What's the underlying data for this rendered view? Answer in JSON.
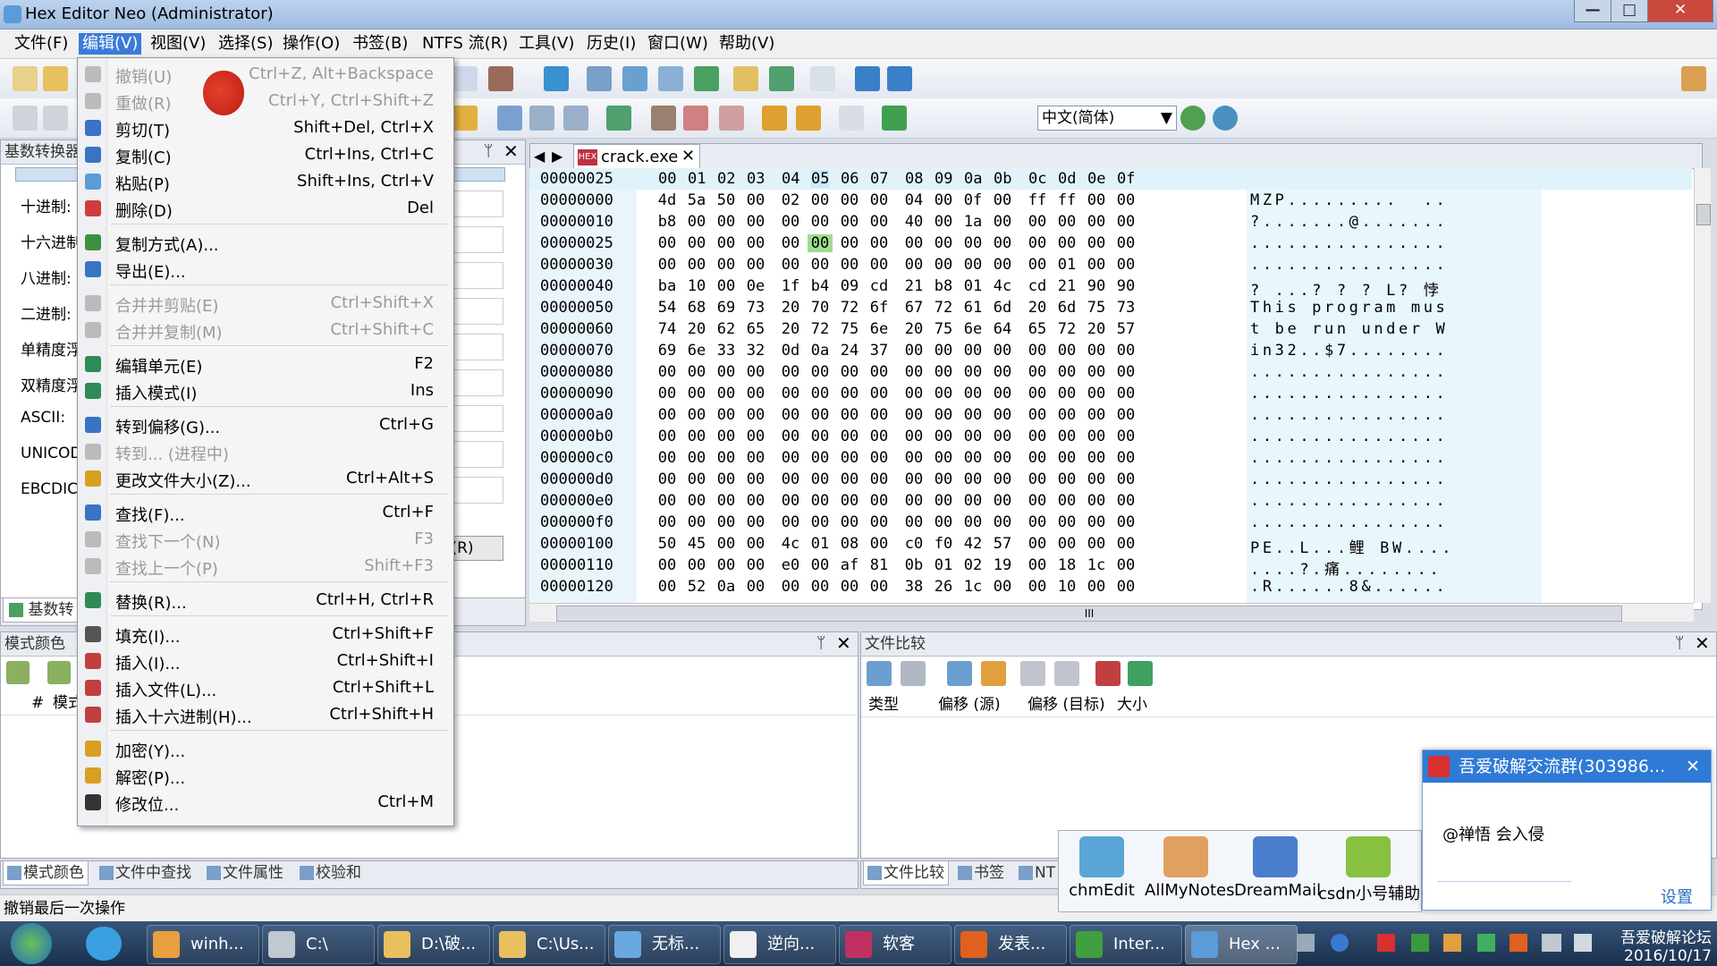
{
  "window": {
    "title": "Hex Editor Neo (Administrator)",
    "min": "—",
    "max": "□",
    "close": "✕"
  },
  "menubar": [
    {
      "label": "文件(F)"
    },
    {
      "label": "编辑(V)"
    },
    {
      "label": "视图(V)"
    },
    {
      "label": "选择(S)"
    },
    {
      "label": "操作(O)"
    },
    {
      "label": "书签(B)"
    },
    {
      "label": "NTFS 流(R)"
    },
    {
      "label": "工具(V)"
    },
    {
      "label": "历史(I)"
    },
    {
      "label": "窗口(W)"
    },
    {
      "label": "帮助(V)"
    }
  ],
  "language_select": {
    "value": "中文(简体)"
  },
  "edit_menu": [
    {
      "label": "撤销(U)",
      "shortcut": "Ctrl+Z, Alt+Backspace",
      "disabled": true,
      "icon": "undo-icon",
      "color": "#bbbbbb"
    },
    {
      "label": "重做(R)",
      "shortcut": "Ctrl+Y, Ctrl+Shift+Z",
      "disabled": true,
      "icon": "redo-icon",
      "color": "#bbbbbb"
    },
    {
      "label": "剪切(T)",
      "shortcut": "Shift+Del, Ctrl+X",
      "disabled": false,
      "icon": "cut-icon",
      "color": "#3a73c4"
    },
    {
      "label": "复制(C)",
      "shortcut": "Ctrl+Ins, Ctrl+C",
      "disabled": false,
      "icon": "copy-icon",
      "color": "#3a73c4"
    },
    {
      "label": "粘贴(P)",
      "shortcut": "Shift+Ins, Ctrl+V",
      "disabled": false,
      "icon": "paste-icon",
      "color": "#5a9bd8"
    },
    {
      "label": "删除(D)",
      "shortcut": "Del",
      "disabled": false,
      "icon": "delete-icon",
      "color": "#d23b3b"
    },
    {
      "label": "复制方式(A)...",
      "shortcut": "",
      "disabled": false,
      "icon": "copy-as-icon",
      "color": "#3f8f3f"
    },
    {
      "label": "导出(E)...",
      "shortcut": "",
      "disabled": false,
      "icon": "export-icon",
      "color": "#3a73c4"
    },
    {
      "label": "合并并剪贴(E)",
      "shortcut": "Ctrl+Shift+X",
      "disabled": true,
      "icon": "merge-cut-icon",
      "color": "#bbbbbb"
    },
    {
      "label": "合并并复制(M)",
      "shortcut": "Ctrl+Shift+C",
      "disabled": true,
      "icon": "merge-copy-icon",
      "color": "#bbbbbb"
    },
    {
      "label": "编辑单元(E)",
      "shortcut": "F2",
      "disabled": false,
      "icon": "edit-cell-icon",
      "color": "#2e8b57"
    },
    {
      "label": "插入模式(I)",
      "shortcut": "Ins",
      "disabled": false,
      "icon": "insert-mode-icon",
      "color": "#2e8b57"
    },
    {
      "label": "转到偏移(G)...",
      "shortcut": "Ctrl+G",
      "disabled": false,
      "icon": "goto-icon",
      "color": "#3a73c4"
    },
    {
      "label": "转到... (进程中)",
      "shortcut": "",
      "disabled": true,
      "icon": "goto-process-icon",
      "color": "#bbbbbb"
    },
    {
      "label": "更改文件大小(Z)...",
      "shortcut": "Ctrl+Alt+S",
      "disabled": false,
      "icon": "resize-icon",
      "color": "#d8a020"
    },
    {
      "label": "查找(F)...",
      "shortcut": "Ctrl+F",
      "disabled": false,
      "icon": "find-icon",
      "color": "#3a73c4"
    },
    {
      "label": "查找下一个(N)",
      "shortcut": "F3",
      "disabled": true,
      "icon": "find-next-icon",
      "color": "#bbbbbb"
    },
    {
      "label": "查找上一个(P)",
      "shortcut": "Shift+F3",
      "disabled": true,
      "icon": "find-prev-icon",
      "color": "#bbbbbb"
    },
    {
      "label": "替换(R)...",
      "shortcut": "Ctrl+H, Ctrl+R",
      "disabled": false,
      "icon": "replace-icon",
      "color": "#2e8b57"
    },
    {
      "label": "填充(I)...",
      "shortcut": "Ctrl+Shift+F",
      "disabled": false,
      "icon": "fill-icon",
      "color": "#555555"
    },
    {
      "label": "插入(I)...",
      "shortcut": "Ctrl+Shift+I",
      "disabled": false,
      "icon": "insert-icon",
      "color": "#c04040"
    },
    {
      "label": "插入文件(L)...",
      "shortcut": "Ctrl+Shift+L",
      "disabled": false,
      "icon": "insert-file-icon",
      "color": "#c04040"
    },
    {
      "label": "插入十六进制(H)...",
      "shortcut": "Ctrl+Shift+H",
      "disabled": false,
      "icon": "insert-hex-icon",
      "color": "#c04040"
    },
    {
      "label": "加密(Y)...",
      "shortcut": "",
      "disabled": false,
      "icon": "lock-icon",
      "color": "#d8a020"
    },
    {
      "label": "解密(P)...",
      "shortcut": "",
      "disabled": false,
      "icon": "unlock-icon",
      "color": "#d8a020"
    },
    {
      "label": "修改位...",
      "shortcut": "Ctrl+M",
      "disabled": false,
      "icon": "bits-icon",
      "color": "#333333"
    }
  ],
  "base_converter": {
    "title": "基数转换器",
    "rows": [
      "十进制:",
      "十六进制:",
      "八进制:",
      "二进制:",
      "单精度浮",
      "双精度浮",
      "ASCII:",
      "UNICOD",
      "EBCDIC:"
    ],
    "button": "(R)",
    "tab": "基数转"
  },
  "hex_editor": {
    "tab": "crack.exe",
    "header_offset": "00000025",
    "header_cols": [
      "00",
      "01",
      "02",
      "03",
      "04",
      "05",
      "06",
      "07",
      "08",
      "09",
      "0a",
      "0b",
      "0c",
      "0d",
      "0e",
      "0f"
    ],
    "rows": [
      {
        "off": "00000000",
        "bytes": [
          "4d",
          "5a",
          "50",
          "00",
          "02",
          "00",
          "00",
          "00",
          "04",
          "00",
          "0f",
          "00",
          "ff",
          "ff",
          "00",
          "00"
        ],
        "ascii": "MZP.........  .."
      },
      {
        "off": "00000010",
        "bytes": [
          "b8",
          "00",
          "00",
          "00",
          "00",
          "00",
          "00",
          "00",
          "40",
          "00",
          "1a",
          "00",
          "00",
          "00",
          "00",
          "00"
        ],
        "ascii": "?.......@......."
      },
      {
        "off": "00000025",
        "bytes": [
          "00",
          "00",
          "00",
          "00",
          "00",
          "00",
          "00",
          "00",
          "00",
          "00",
          "00",
          "00",
          "00",
          "00",
          "00",
          "00"
        ],
        "ascii": "................"
      },
      {
        "off": "00000030",
        "bytes": [
          "00",
          "00",
          "00",
          "00",
          "00",
          "00",
          "00",
          "00",
          "00",
          "00",
          "00",
          "00",
          "00",
          "01",
          "00",
          "00"
        ],
        "ascii": "................"
      },
      {
        "off": "00000040",
        "bytes": [
          "ba",
          "10",
          "00",
          "0e",
          "1f",
          "b4",
          "09",
          "cd",
          "21",
          "b8",
          "01",
          "4c",
          "cd",
          "21",
          "90",
          "90"
        ],
        "ascii": "? ...? ? ? L? 悖"
      },
      {
        "off": "00000050",
        "bytes": [
          "54",
          "68",
          "69",
          "73",
          "20",
          "70",
          "72",
          "6f",
          "67",
          "72",
          "61",
          "6d",
          "20",
          "6d",
          "75",
          "73"
        ],
        "ascii": "This program mus"
      },
      {
        "off": "00000060",
        "bytes": [
          "74",
          "20",
          "62",
          "65",
          "20",
          "72",
          "75",
          "6e",
          "20",
          "75",
          "6e",
          "64",
          "65",
          "72",
          "20",
          "57"
        ],
        "ascii": "t be run under W"
      },
      {
        "off": "00000070",
        "bytes": [
          "69",
          "6e",
          "33",
          "32",
          "0d",
          "0a",
          "24",
          "37",
          "00",
          "00",
          "00",
          "00",
          "00",
          "00",
          "00",
          "00"
        ],
        "ascii": "in32..$7........"
      },
      {
        "off": "00000080",
        "bytes": [
          "00",
          "00",
          "00",
          "00",
          "00",
          "00",
          "00",
          "00",
          "00",
          "00",
          "00",
          "00",
          "00",
          "00",
          "00",
          "00"
        ],
        "ascii": "................"
      },
      {
        "off": "00000090",
        "bytes": [
          "00",
          "00",
          "00",
          "00",
          "00",
          "00",
          "00",
          "00",
          "00",
          "00",
          "00",
          "00",
          "00",
          "00",
          "00",
          "00"
        ],
        "ascii": "................"
      },
      {
        "off": "000000a0",
        "bytes": [
          "00",
          "00",
          "00",
          "00",
          "00",
          "00",
          "00",
          "00",
          "00",
          "00",
          "00",
          "00",
          "00",
          "00",
          "00",
          "00"
        ],
        "ascii": "................"
      },
      {
        "off": "000000b0",
        "bytes": [
          "00",
          "00",
          "00",
          "00",
          "00",
          "00",
          "00",
          "00",
          "00",
          "00",
          "00",
          "00",
          "00",
          "00",
          "00",
          "00"
        ],
        "ascii": "................"
      },
      {
        "off": "000000c0",
        "bytes": [
          "00",
          "00",
          "00",
          "00",
          "00",
          "00",
          "00",
          "00",
          "00",
          "00",
          "00",
          "00",
          "00",
          "00",
          "00",
          "00"
        ],
        "ascii": "................"
      },
      {
        "off": "000000d0",
        "bytes": [
          "00",
          "00",
          "00",
          "00",
          "00",
          "00",
          "00",
          "00",
          "00",
          "00",
          "00",
          "00",
          "00",
          "00",
          "00",
          "00"
        ],
        "ascii": "................"
      },
      {
        "off": "000000e0",
        "bytes": [
          "00",
          "00",
          "00",
          "00",
          "00",
          "00",
          "00",
          "00",
          "00",
          "00",
          "00",
          "00",
          "00",
          "00",
          "00",
          "00"
        ],
        "ascii": "................"
      },
      {
        "off": "000000f0",
        "bytes": [
          "00",
          "00",
          "00",
          "00",
          "00",
          "00",
          "00",
          "00",
          "00",
          "00",
          "00",
          "00",
          "00",
          "00",
          "00",
          "00"
        ],
        "ascii": "................"
      },
      {
        "off": "00000100",
        "bytes": [
          "50",
          "45",
          "00",
          "00",
          "4c",
          "01",
          "08",
          "00",
          "c0",
          "f0",
          "42",
          "57",
          "00",
          "00",
          "00",
          "00"
        ],
        "ascii": "PE..L...鲤 BW...."
      },
      {
        "off": "00000110",
        "bytes": [
          "00",
          "00",
          "00",
          "00",
          "e0",
          "00",
          "af",
          "81",
          "0b",
          "01",
          "02",
          "19",
          "00",
          "18",
          "1c",
          "00"
        ],
        "ascii": "....?.痛........"
      },
      {
        "off": "00000120",
        "bytes": [
          "00",
          "52",
          "0a",
          "00",
          "00",
          "00",
          "00",
          "00",
          "38",
          "26",
          "1c",
          "00",
          "00",
          "10",
          "00",
          "00"
        ],
        "ascii": ".R......8&......"
      }
    ],
    "selected_row": 2,
    "selected_col": 5,
    "scroll_label": "III"
  },
  "pattern_panel": {
    "title": "模式颜色",
    "col_hash": "#",
    "col_name": "模式"
  },
  "compare_panel": {
    "title": "文件比较",
    "cols": [
      "类型",
      "偏移 (源)",
      "偏移 (目标)",
      "大小"
    ]
  },
  "bottom_tabs_left": [
    "模式颜色",
    "文件中查找",
    "文件属性",
    "校验和"
  ],
  "bottom_tabs_right": [
    "文件比较",
    "书签",
    "NT"
  ],
  "status": "撤销最后一次操作",
  "launcher": [
    {
      "label": "chmEdit",
      "color": "#59a6d6"
    },
    {
      "label": "AllMyNotes",
      "color": "#e0a060"
    },
    {
      "label": "DreamMail",
      "color": "#4a7ecc"
    },
    {
      "label": "csdn小号辅助",
      "color": "#88c040"
    }
  ],
  "notification": {
    "title": "吾爱破解交流群(303986...",
    "message": "@禅悟 会入侵",
    "settings": "设置"
  },
  "taskbar": [
    {
      "label": "winh...",
      "color": "#e8a040"
    },
    {
      "label": "C:\\",
      "color": "#c0c8d0"
    },
    {
      "label": "D:\\破...",
      "color": "#e8c060"
    },
    {
      "label": "C:\\Us...",
      "color": "#e8c060"
    },
    {
      "label": "无标...",
      "color": "#6aa8e0"
    },
    {
      "label": "逆向...",
      "color": "#f0f0f0"
    },
    {
      "label": "软客",
      "color": "#c03060"
    },
    {
      "label": "发表...",
      "color": "#e06020"
    },
    {
      "label": "Inter...",
      "color": "#40a040"
    },
    {
      "label": "Hex ...",
      "color": "#5a9bd8"
    }
  ],
  "tray": {
    "line1": "吾爱破解论坛",
    "line2": "2016/10/17"
  }
}
